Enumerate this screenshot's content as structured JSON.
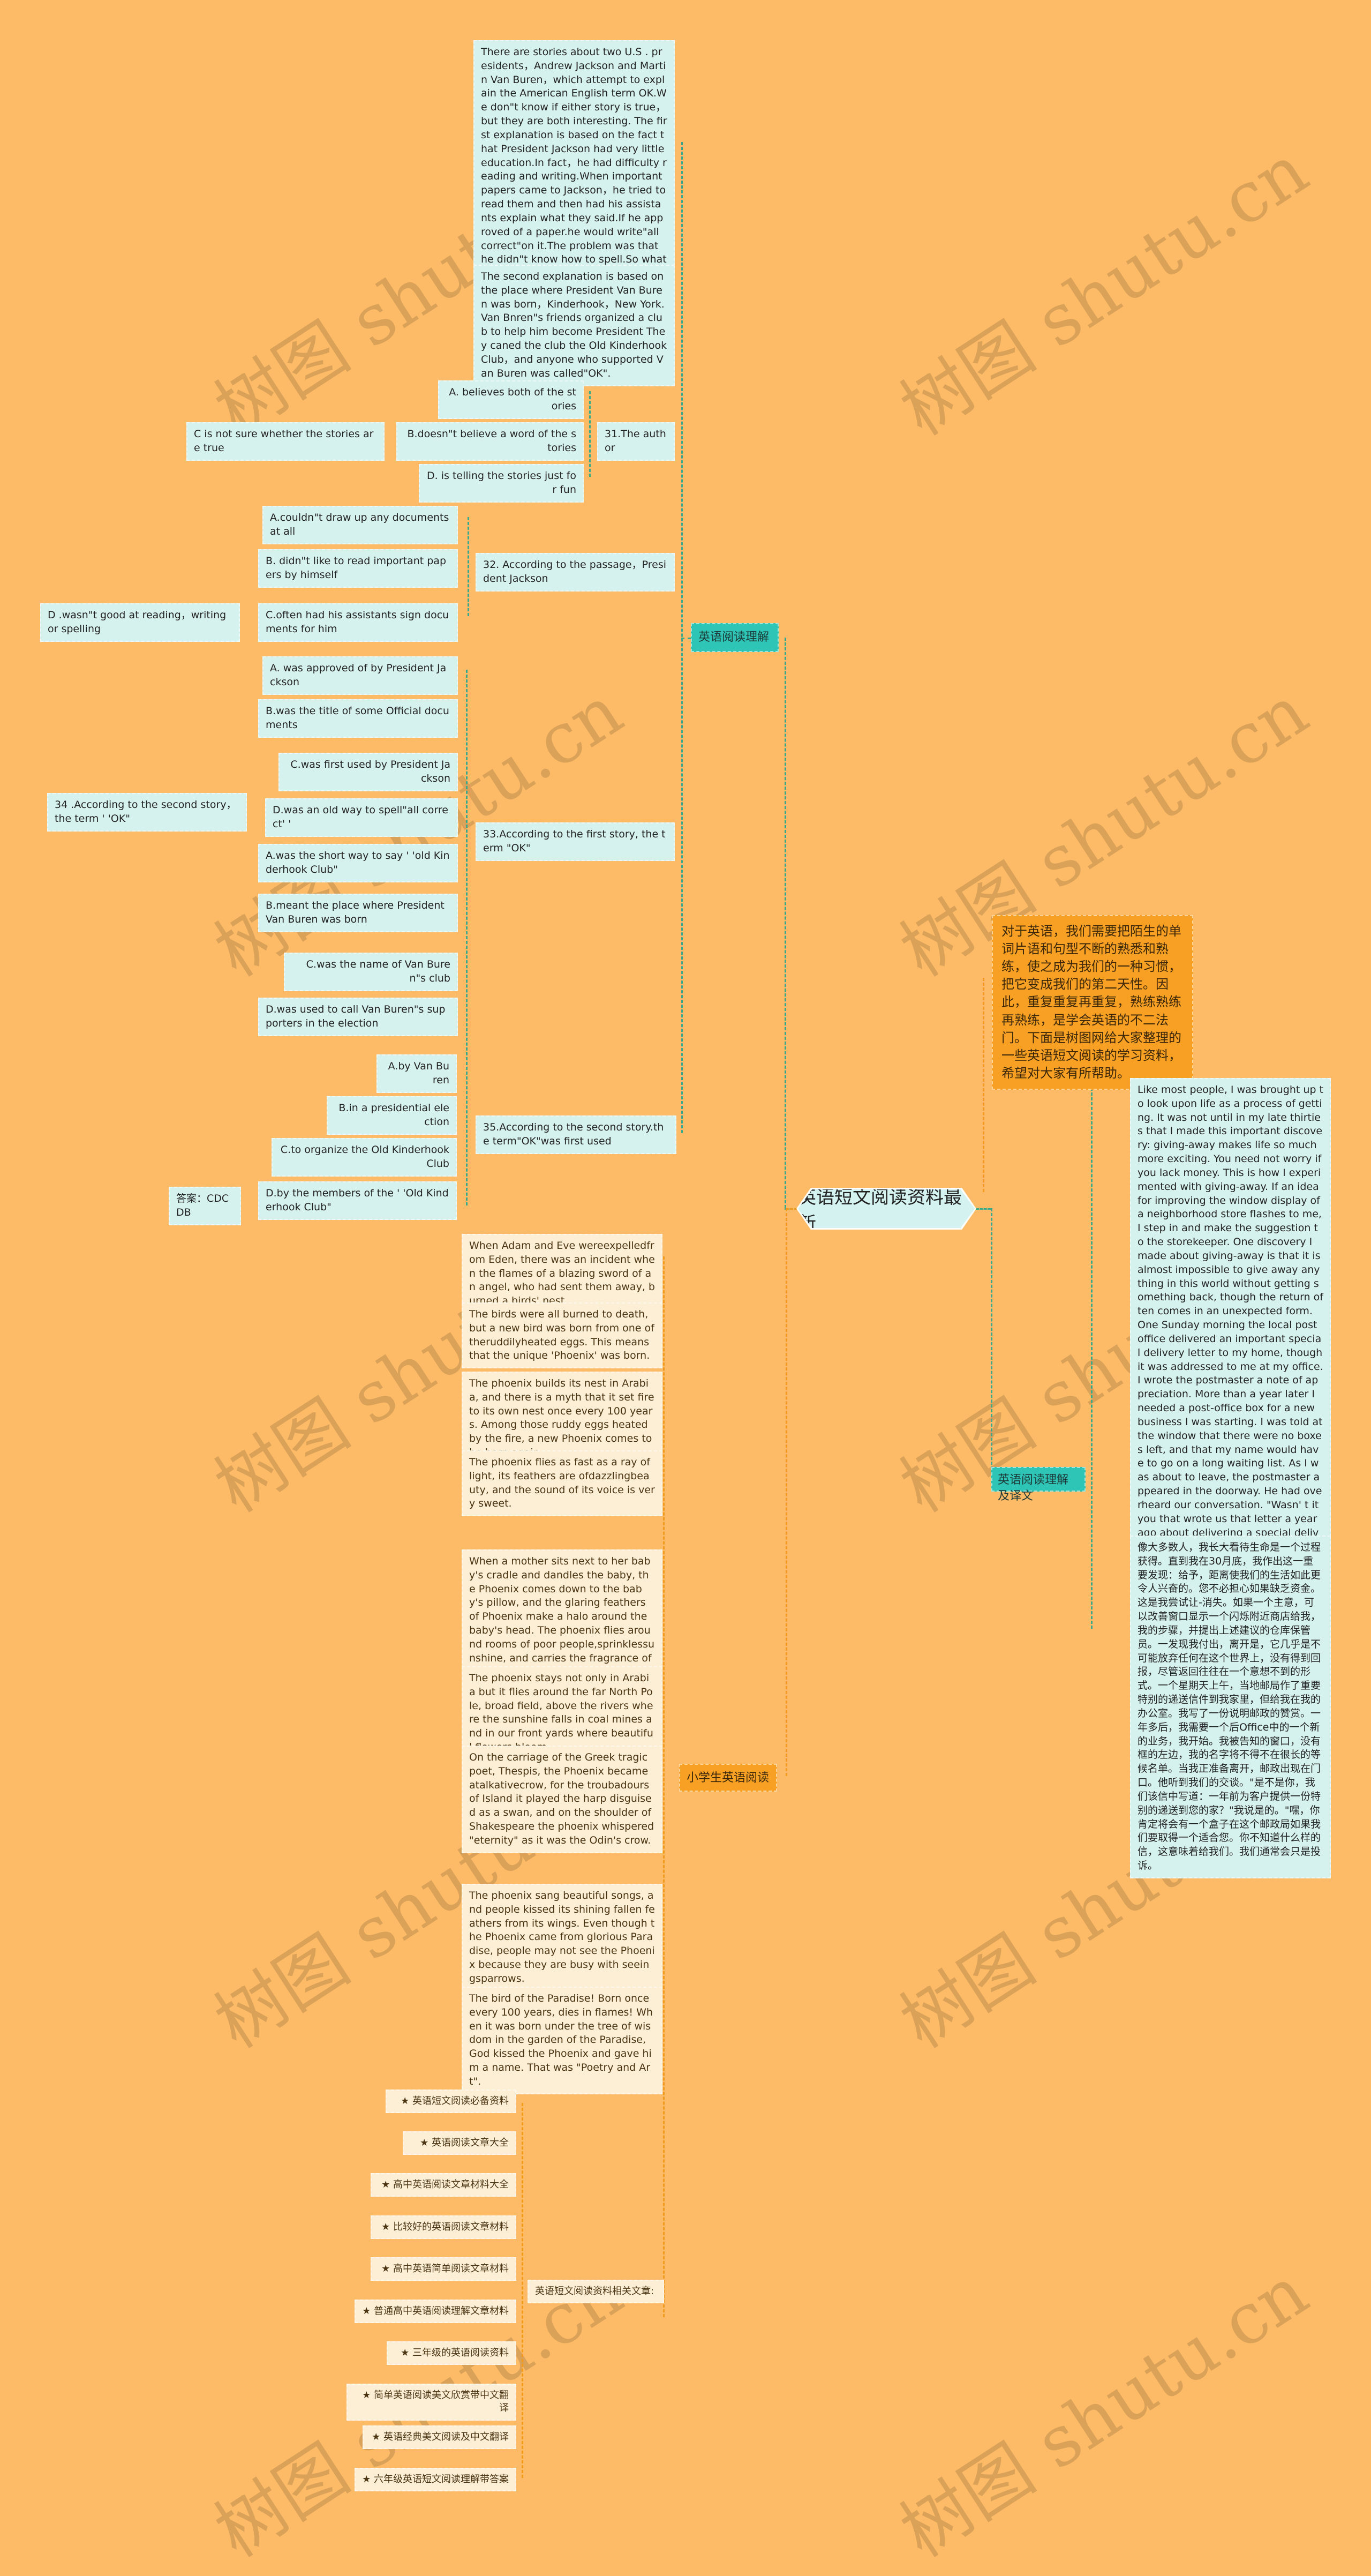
{
  "watermark": "树图 shutu.cn",
  "colors": {
    "background": "#fdbb67",
    "cyan_node": "#d6f2ee",
    "teal_node": "#2ec4b6",
    "orange_node": "#f8a024",
    "cream_node": "#fdefd6",
    "green_connector": "#3aa88a",
    "orange_connector": "#f29a1c"
  },
  "root": {
    "label": "英语短文阅读资料最新"
  },
  "intro": "对于英语，我们需要把陌生的单词片语和句型不断的熟悉和熟练，使之成为我们的一种习惯，把它变成我们的第二天性。因此，重复重复再重复，熟练熟练再熟练，是学会英语的不二法门。下面是树图网给大家整理的一些英语短文阅读的学习资料，希望对大家有所帮助。",
  "reading_comprehension": {
    "label": "英语阅读理解",
    "passages": [
      "There are stories about two U.S . presidents，Andrew Jackson and Martin Van Buren，which attempt to explain the American English term OK.We don\"t know if either story is true，but they are both interesting. The first explanation is based on the fact that President Jackson had very little education.In fact，he had difficulty reading and writing.When important papers came to Jackson，he tried to read them and then had his assistants explain what they said.If he approved of a paper.he would write\"all correct\"on it.The problem was that he didn\"t know how to spell.So what he really wrote was\"ol korekt\".After a while，he shortened that term to\"OK\".",
      "The second explanation is based on the place where President Van Buren was born，Kinderhook，New York.Van Bnren\"s friends organized a club to help him become President They caned the club the Old Kinderhook Club，and anyone who supported Van Buren was called\"OK\"."
    ],
    "questions": [
      {
        "question": "31.The author",
        "options": [
          "A. believes both of the stories",
          "B.doesn\"t believe a word of the stories",
          "D. is telling the stories just for fun"
        ],
        "extra": "C is not sure whether the stories are true"
      },
      {
        "question": "32. According to the passage，President Jackson",
        "options": [
          "A.couldn\"t draw up any documents at all",
          "B. didn\"t like to read important papers by himself",
          "C.often had his assistants sign documents for him"
        ],
        "extra": "D .wasn\"t good at reading，writing or spelling"
      },
      {
        "question": "33.According to the first story, the term \"OK\"",
        "options": [
          "A. was approved of by President Jackson",
          "B.was the title of some Official documents",
          "C.was first used by President Jackson",
          "D.was an old way to spell\"all correct'  '",
          "A.was the short way to say  '  'old Kinderhook Club\"",
          "B.meant the place where President Van Buren was born",
          "C.was the name of Van Buren\"s club",
          "D.was used to call Van Buren\"s supporters in the election"
        ],
        "extra": "34 .According to the second story，the term  '  'OK\""
      },
      {
        "question": "35.According to the second story.the term\"OK\"was first used",
        "options": [
          "A.by Van Buren",
          "B.in a presidential election",
          "C.to organize the Old Kinderhook Club",
          "D.by the members of the  '  'Old Kinderhook Club\""
        ],
        "extra": "答案：CDCDB"
      }
    ]
  },
  "translation_branch": {
    "label": "英语阅读理解及译文",
    "english": "Like most people, I was brought up to look upon life as a process of getting. It was not until in my late thirties that I made this important discovery: giving-away makes life so much more exciting. You need not worry if you lack money. This is how I experimented with giving-away. If an idea for improving the window display of a neighborhood store flashes to me, I step in and make the suggestion to the storekeeper. One discovery I made about giving-away is that it is almost impossible to give away anything in this world without getting something back, though the return often comes in an unexpected form. One Sunday morning the local post office delivered an important special delivery letter to my home, though it was addressed to me at my office. I wrote the postmaster a note of appreciation. More than a year later I needed a post-office box for a new business I was starting. I was told at the window that there were no boxes left, and that my name would have to go on a long waiting list. As I was about to leave, the postmaster appeared in the doorway. He had overheard our conversation. \"Wasn' t it you that wrote us that letter a year ago about delivering a special delivery to your home?\" I said yes. \"Well, you certainly are going to have a box in this post office if we have to make one for you. You don ' t know what a letter like that means to us. We usually get nothing but complaints.\"",
    "chinese": "像大多数人，我长大看待生命是一个过程获得。直到我在30月底，我作出这一重要发现：给予，距离使我们的生活如此更令人兴奋的。您不必担心如果缺乏资金。这是我尝试让-消失。如果一个主意，可以改善窗口显示一个闪烁附近商店给我，我的步骤，并提出上述建议的仓库保管员。一发现我付出，离开是，它几乎是不可能放弃任何在这个世界上，没有得到回报，尽管返回往往在一个意想不到的形式。一个星期天上午，当地邮局作了重要特别的递送信件到我家里，但给我在我的办公室。我写了一份说明邮政的赞赏。一年多后，我需要一个后Office中的一个新的业务，我开始。我被告知的窗口，没有框的左边，我的名字将不得不在很长的等候名单。当我正准备离开，邮政出现在门口。他听到我们的交谈。\"是不是你，我们该信中写道：一年前为客户提供一份特别的递送到您的家？\"我说是的。\"嘿，你肯定将会有一个盒子在这个邮政局如果我们要取得一个适合您。你不知道什么样的信，这意味着给我们。我们通常会只是投诉。"
  },
  "primary_reading": {
    "label": "小学生英语阅读",
    "passages": [
      "When Adam and Eve wereexpelledfrom Eden, there was an incident when the flames of a blazing sword of an angel, who had sent them away, burned a birds' nest.",
      "The birds were all burned to death, but a new bird was born from one of theruddilyheated eggs. This means that the unique 'Phoenix' was born.",
      "The phoenix builds its nest in Arabia, and there is a myth that it set fire to its own nest once every 100 years. Among those ruddy eggs heated by the fire, a new Phoenix comes to be born again.",
      "The phoenix flies as fast as a ray of light, its feathers are ofdazzlingbeauty, and the sound of its voice is very sweet.",
      "When a mother sits next to her baby's cradle and dandles the baby, the Phoenix comes down to the baby's pillow, and the glaring feathers of Phoenix make a halo around the baby's head. The phoenix flies around rooms of poor people,sprinklessunshine, and carries the fragrance of violets into the rooms.",
      "The phoenix stays not only in Arabia but it flies around the far North Pole, broad field, above the rivers where the sunshine falls in coal mines and in our front yards where beautiful flowers bloom.",
      "On the carriage of the Greek tragic poet, Thespis, the Phoenix became atalkativecrow, for the troubadours of Island it played the harp disguised as a swan, and on the shoulder of Shakespeare the phoenix whispered \"eternity\" as it was the Odin's crow.",
      "The phoenix sang beautiful songs, and people kissed its shining fallen feathers from its wings. Even though the Phoenix came from glorious Paradise, people may not see the Phoenix because they are busy with seeingsparrows.",
      "The bird of the Paradise! Born once every 100 years, dies in flames! When it was born under the tree of wisdom in the garden of the Paradise, God kissed the Phoenix and gave him a name. That was \"Poetry and Art\"."
    ]
  },
  "related": {
    "label": "英语短文阅读资料相关文章:",
    "star_icon": "★",
    "links": [
      "英语短文阅读必备资料",
      "英语阅读文章大全",
      "高中英语阅读文章材料大全",
      "比较好的英语阅读文章材料",
      "高中英语简单阅读文章材料",
      "普通高中英语阅读理解文章材料",
      "三年级的英语阅读资料",
      "简单英语阅读美文欣赏带中文翻译",
      "英语经典美文阅读及中文翻译",
      "六年级英语短文阅读理解带答案"
    ]
  }
}
